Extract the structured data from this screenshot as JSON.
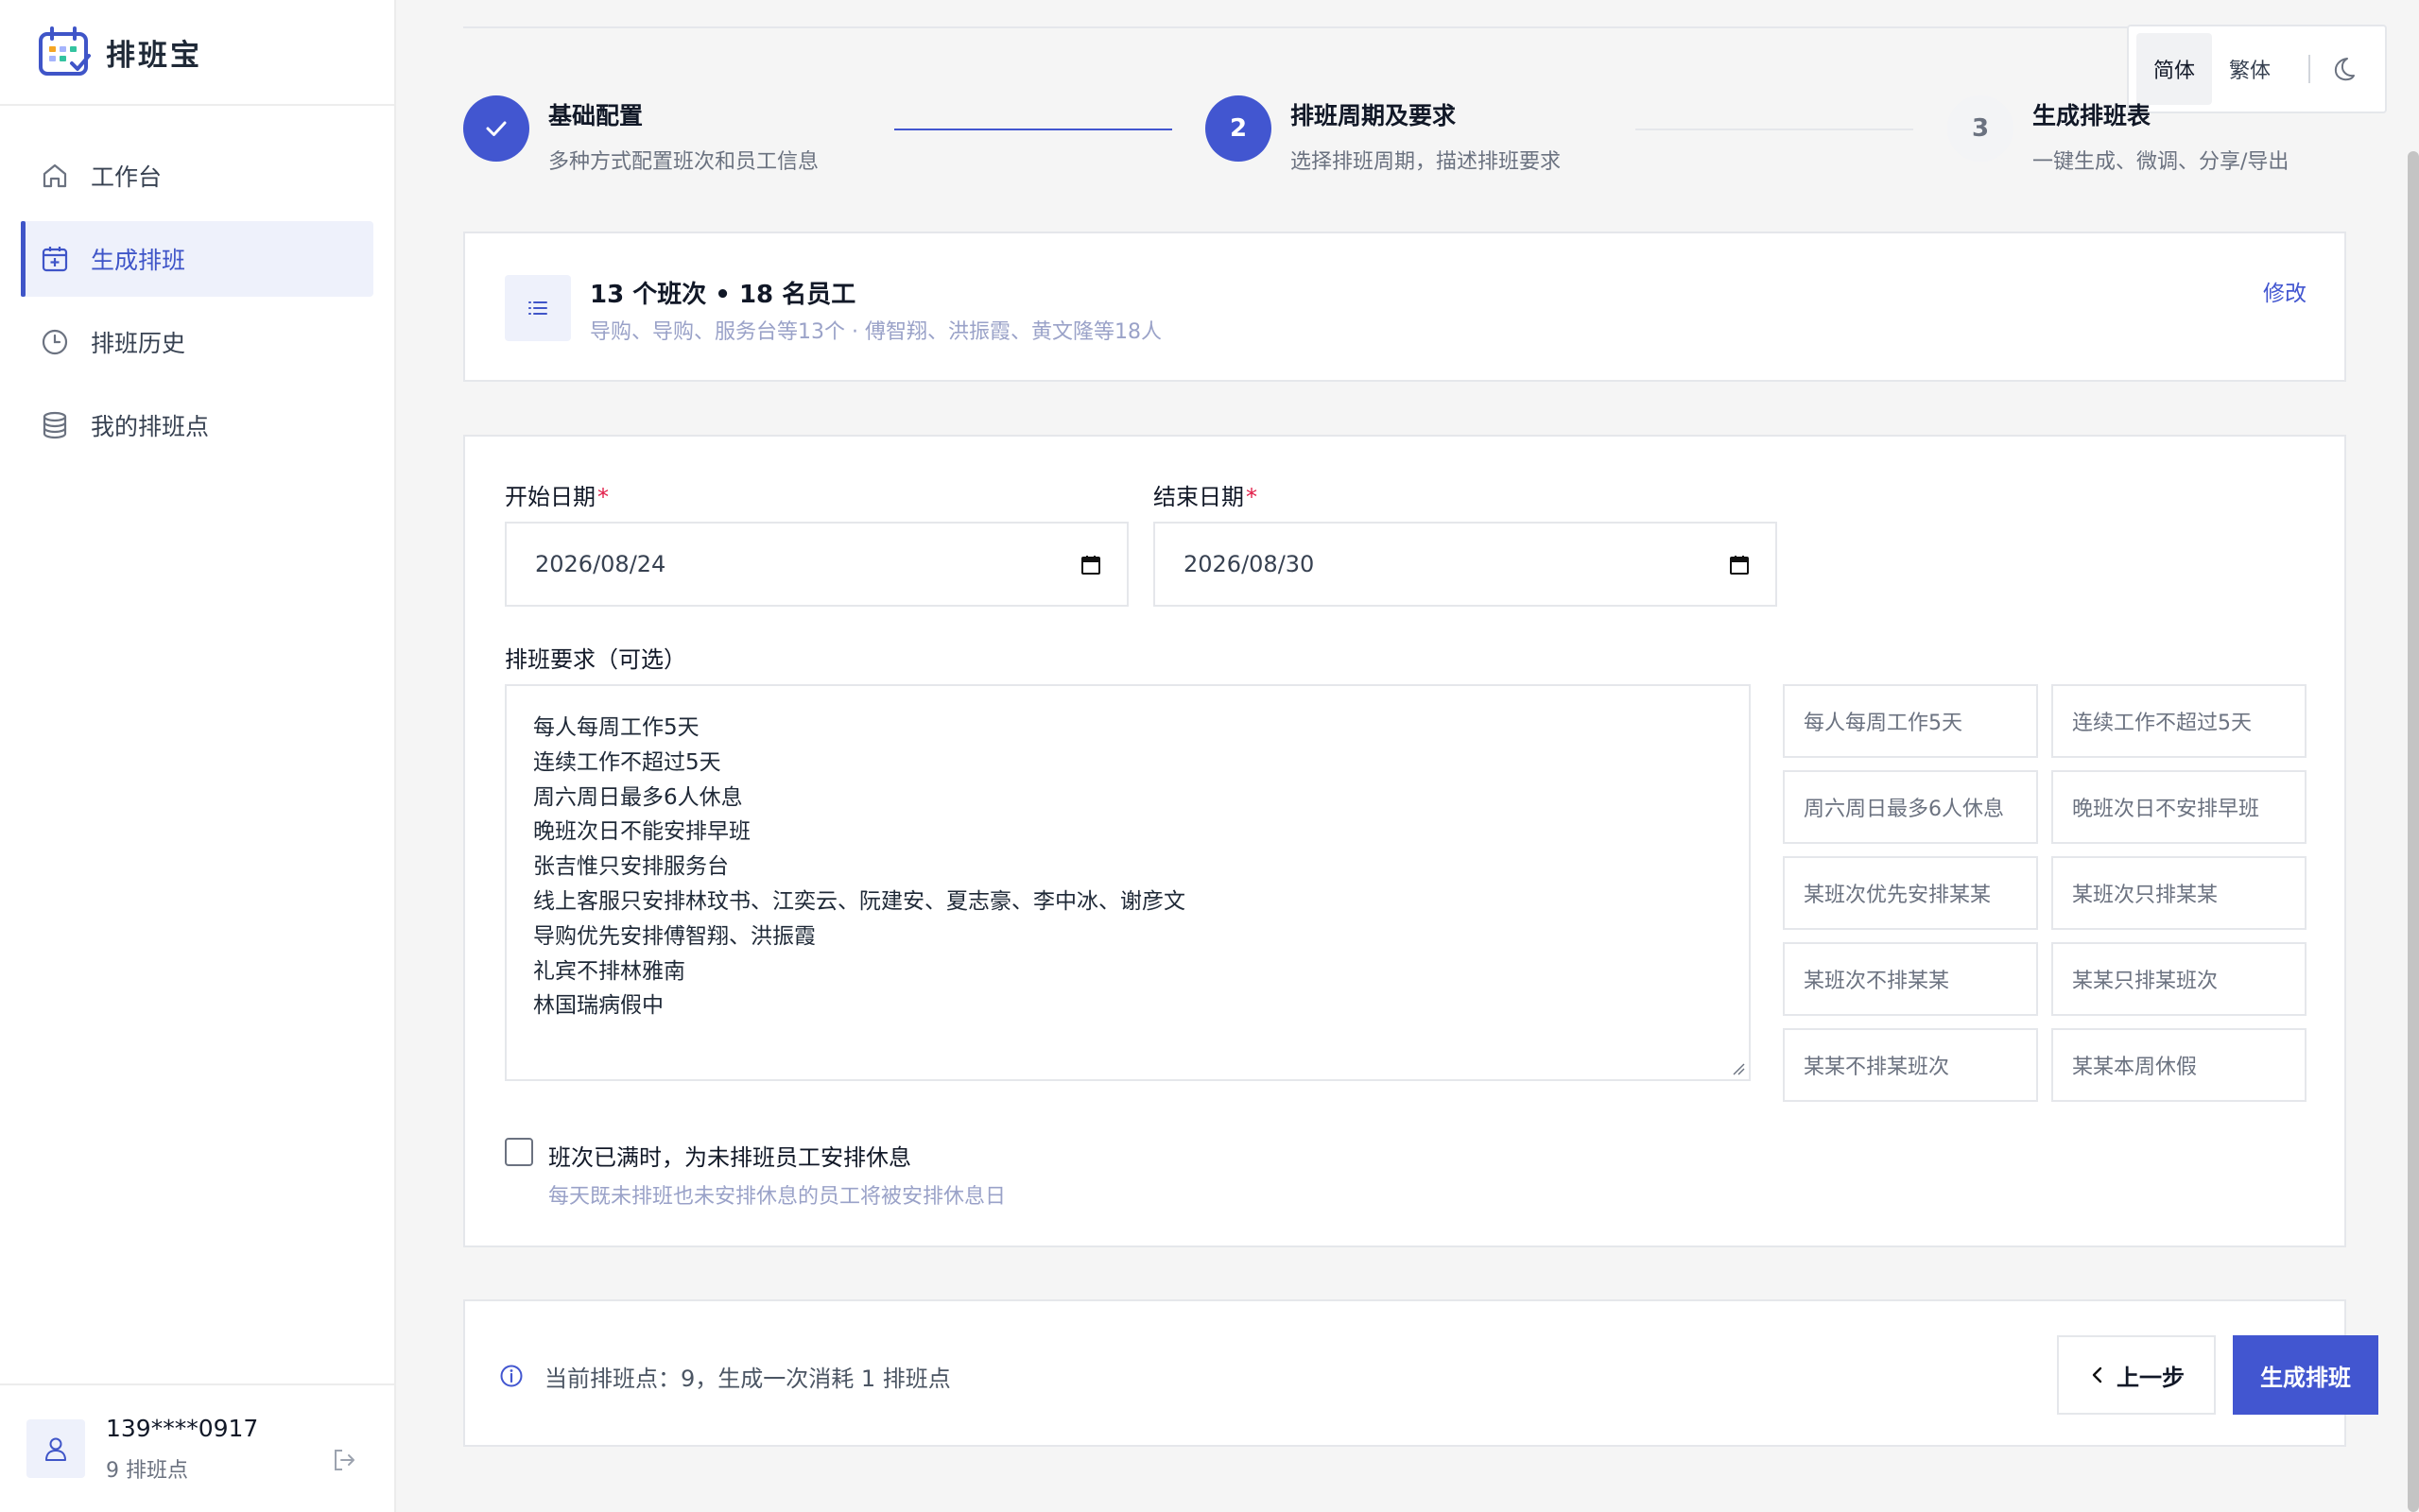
{
  "brand": {
    "name": "排班宝"
  },
  "sidebar": {
    "items": [
      {
        "label": "工作台",
        "icon": "home-icon"
      },
      {
        "label": "生成排班",
        "icon": "calendar-plus-icon"
      },
      {
        "label": "排班历史",
        "icon": "clock-icon"
      },
      {
        "label": "我的排班点",
        "icon": "database-icon"
      }
    ],
    "active_index": 1
  },
  "user": {
    "phone": "139****0917",
    "points": "9 排班点"
  },
  "lang": {
    "simplified": "简体",
    "traditional": "繁体"
  },
  "steps": [
    {
      "number": "1",
      "title": "基础配置",
      "desc": "多种方式配置班次和员工信息",
      "state": "done"
    },
    {
      "number": "2",
      "title": "排班周期及要求",
      "desc": "选择排班周期，描述排班要求",
      "state": "current"
    },
    {
      "number": "3",
      "title": "生成排班表",
      "desc": "一键生成、微调、分享/导出",
      "state": "pending"
    }
  ],
  "summary": {
    "title": "13 个班次 • 18 名员工",
    "subtitle": "导购、导购、服务台等13个 · 傅智翔、洪振霞、黄文隆等18人",
    "edit_label": "修改"
  },
  "form": {
    "start_label": "开始日期",
    "start_value": "2026/08/24",
    "end_label": "结束日期",
    "end_value": "2026/08/30",
    "required_mark": "*",
    "requirements_label": "排班要求（可选）",
    "requirements_lines": [
      "每人每周工作5天",
      "连续工作不超过5天",
      "周六周日最多6人休息",
      "晚班次日不能安排早班",
      "张吉惟只安排服务台",
      "线上客服只安排林玟书、江奕云、阮建安、夏志豪、李中冰、谢彦文",
      "导购优先安排傅智翔、洪振霞",
      "礼宾不排林雅南",
      "林国瑞病假中"
    ],
    "chips": [
      "每人每周工作5天",
      "连续工作不超过5天",
      "周六周日最多6人休息",
      "晚班次日不安排早班",
      "某班次优先安排某某",
      "某班次只排某某",
      "某班次不排某某",
      "某某只排某班次",
      "某某不排某班次",
      "某某本周休假"
    ],
    "checkbox_label": "班次已满时，为未排班员工安排休息",
    "checkbox_hint": "每天既未排班也未安排休息的员工将被安排休息日",
    "checkbox_checked": false
  },
  "footer": {
    "info": "当前排班点：9，生成一次消耗 1 排班点",
    "prev_label": "上一步",
    "generate_label": "生成排班"
  },
  "colors": {
    "accent": "#4256d0",
    "active_bg": "#eef1fb",
    "border": "#e5e7eb"
  }
}
